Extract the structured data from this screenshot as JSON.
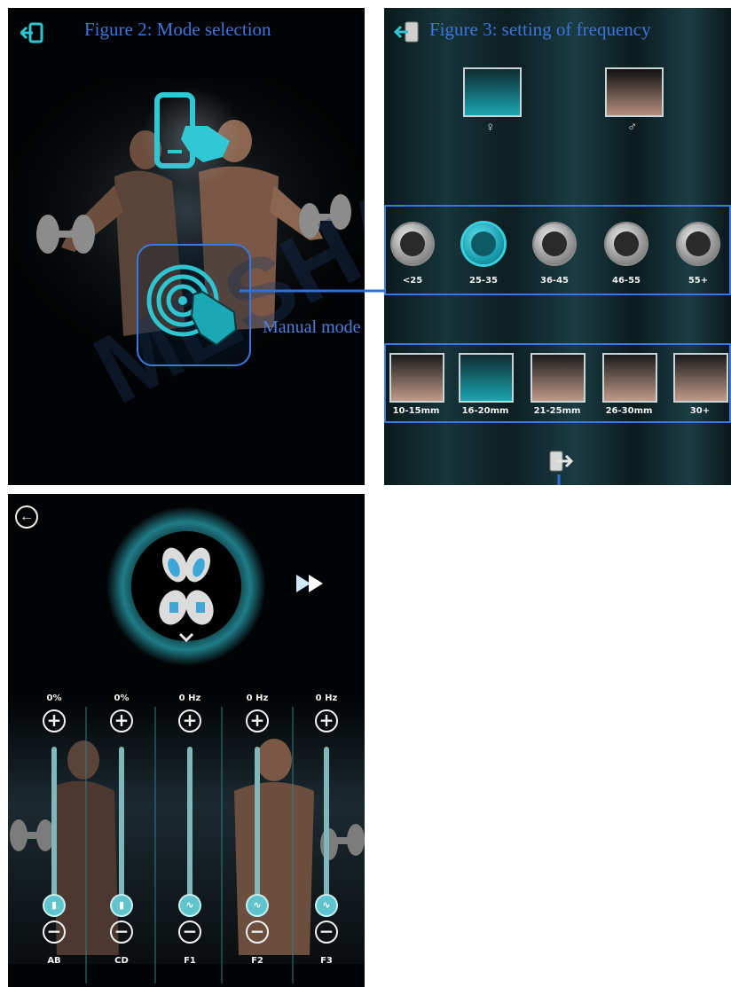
{
  "figure2": {
    "title": "Figure 2: Mode selection",
    "manual_mode_label": "Manual mode",
    "icons": [
      "exit-icon",
      "phone-touch-icon",
      "manual-touch-icon"
    ]
  },
  "figure3": {
    "title": "Figure 3: setting of frequency",
    "gender": [
      {
        "icon": "female-icon"
      },
      {
        "icon": "male-icon"
      }
    ],
    "age_groups": [
      {
        "label": "<25",
        "active": false
      },
      {
        "label": "25-35",
        "active": true
      },
      {
        "label": "36-45",
        "active": false
      },
      {
        "label": "46-55",
        "active": false
      },
      {
        "label": "55+",
        "active": false
      }
    ],
    "thickness": [
      {
        "label": "10-15mm",
        "active": false
      },
      {
        "label": "16-20mm",
        "active": true
      },
      {
        "label": "21-25mm",
        "active": false
      },
      {
        "label": "26-30mm",
        "active": false
      },
      {
        "label": "30+",
        "active": false
      }
    ]
  },
  "figure4": {
    "sliders": [
      {
        "name": "AB",
        "value": "0%",
        "icon": "intensity-icon",
        "level": 0
      },
      {
        "name": "CD",
        "value": "0%",
        "icon": "intensity-icon",
        "level": 0
      },
      {
        "name": "F1",
        "value": "0 Hz",
        "icon": "wave-icon",
        "level": 0
      },
      {
        "name": "F2",
        "value": "0 Hz",
        "icon": "wave-icon",
        "level": 0
      },
      {
        "name": "F3",
        "value": "0 Hz",
        "icon": "wave-icon",
        "level": 0
      }
    ],
    "plus_symbol": "+",
    "minus_symbol": "−",
    "back_symbol": "←"
  },
  "colors": {
    "accent": "#3ad0de",
    "frame": "#3a78e0",
    "title": "#3e74dc"
  }
}
